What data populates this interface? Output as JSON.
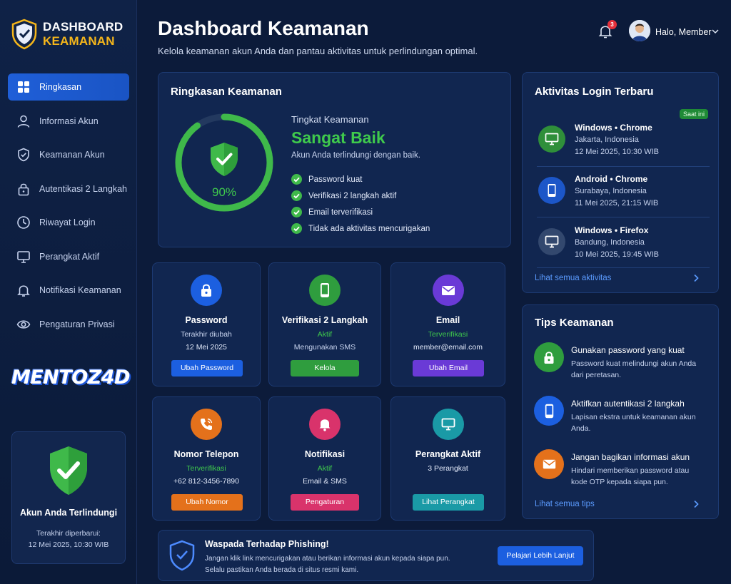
{
  "brand": {
    "line1": "DASHBOARD",
    "line2": "KEAMANAN"
  },
  "sidebar": {
    "items": [
      {
        "label": "Ringkasan",
        "icon": "grid-icon",
        "active": true
      },
      {
        "label": "Informasi Akun",
        "icon": "user-icon"
      },
      {
        "label": "Keamanan Akun",
        "icon": "shield-check-icon"
      },
      {
        "label": "Autentikasi 2 Langkah",
        "icon": "lock-icon"
      },
      {
        "label": "Riwayat Login",
        "icon": "clock-icon"
      },
      {
        "label": "Perangkat Aktif",
        "icon": "monitor-icon"
      },
      {
        "label": "Notifikasi Keamanan",
        "icon": "bell-icon"
      },
      {
        "label": "Pengaturan Privasi",
        "icon": "eye-icon"
      }
    ],
    "logo_text": "MENTOZ4D",
    "protect_card": {
      "title": "Akun Anda Terlindungi",
      "updated_label": "Terakhir diperbarui:",
      "updated_value": "12 Mei 2025, 10:30 WIB"
    }
  },
  "header": {
    "title": "Dashboard Keamanan",
    "subtitle": "Kelola keamanan akun Anda dan pantau aktivitas untuk perlindungan optimal.",
    "notification_count": "3",
    "greeting": "Halo, Member"
  },
  "summary": {
    "title": "Ringkasan Keamanan",
    "score_label": "90%",
    "score_fraction": 0.9,
    "level_label": "Tingkat Keamanan",
    "level_value": "Sangat Baik",
    "level_desc": "Akun Anda terlindungi dengan baik.",
    "checks": [
      "Password kuat",
      "Verifikasi 2 langkah aktif",
      "Email terverifikasi",
      "Tidak ada aktivitas mencurigakan"
    ]
  },
  "cards": [
    {
      "title": "Password",
      "line2": "Terakhir diubah",
      "line3": "12 Mei 2025",
      "button": "Ubah Password",
      "color": "#1c5fe0",
      "icon": "lock-icon"
    },
    {
      "title": "Verifikasi 2 Langkah",
      "line2": "Aktif",
      "line3": "Mengunakan SMS",
      "button": "Kelola",
      "color": "#2f9d3e",
      "icon": "phone-icon"
    },
    {
      "title": "Email",
      "line2": "Terverifikasi",
      "line3": "member@email.com",
      "button": "Ubah Email",
      "color": "#6a3ad6",
      "icon": "mail-icon"
    },
    {
      "title": "Nomor Telepon",
      "line2": "Terverifikasi",
      "line3": "+62 812-3456-7890",
      "button": "Ubah Nomor",
      "color": "#e4711b",
      "icon": "phone-call-icon"
    },
    {
      "title": "Notifikasi",
      "line2": "Aktif",
      "line3": "Email & SMS",
      "button": "Pengaturan",
      "color": "#d9336b",
      "icon": "bell-icon"
    },
    {
      "title": "Perangkat Aktif",
      "line2": "3 Perangkat",
      "line3": "",
      "button": "Lihat Perangkat",
      "color": "#1a9aa6",
      "icon": "monitor-icon"
    }
  ],
  "login_activity": {
    "title": "Aktivitas Login Terbaru",
    "now_badge": "Saat ini",
    "items": [
      {
        "device": "Windows • Chrome",
        "location": "Jakarta, Indonesia",
        "time": "12 Mei 2025, 10:30 WIB",
        "icon": "monitor-icon",
        "color": "#2f8f3a"
      },
      {
        "device": "Android • Chrome",
        "location": "Surabaya, Indonesia",
        "time": "11 Mei 2025, 21:15 WIB",
        "icon": "smartphone-icon",
        "color": "#1c56c8"
      },
      {
        "device": "Windows • Firefox",
        "location": "Bandung, Indonesia",
        "time": "10 Mei 2025, 19:45 WIB",
        "icon": "monitor-icon",
        "color": "#33486e"
      }
    ],
    "see_all": "Lihat semua aktivitas"
  },
  "tips": {
    "title": "Tips Keamanan",
    "items": [
      {
        "title": "Gunakan password yang kuat",
        "desc": "Password kuat melindungi akun Anda dari peretasan.",
        "icon": "lock-icon",
        "color": "#2f9d3e"
      },
      {
        "title": "Aktifkan autentikasi 2 langkah",
        "desc": "Lapisan ekstra untuk keamanan akun Anda.",
        "icon": "smartphone-icon",
        "color": "#1c5fe0"
      },
      {
        "title": "Jangan bagikan informasi akun",
        "desc": "Hindari memberikan password atau kode OTP kepada siapa pun.",
        "icon": "mail-icon",
        "color": "#e4711b"
      }
    ],
    "see_all": "Lihat semua tips"
  },
  "phishing": {
    "title": "Waspada Terhadap Phishing!",
    "line1": "Jangan klik link mencurigakan atau berikan informasi akun kepada siapa pun.",
    "line2": "Selalu pastikan Anda berada di situs resmi kami.",
    "button": "Pelajari Lebih Lanjut"
  },
  "colors": {
    "accent": "#1c5fe0",
    "success": "#3fca4c",
    "brand_gold": "#f5b61b",
    "background": "#0c1b3a"
  }
}
